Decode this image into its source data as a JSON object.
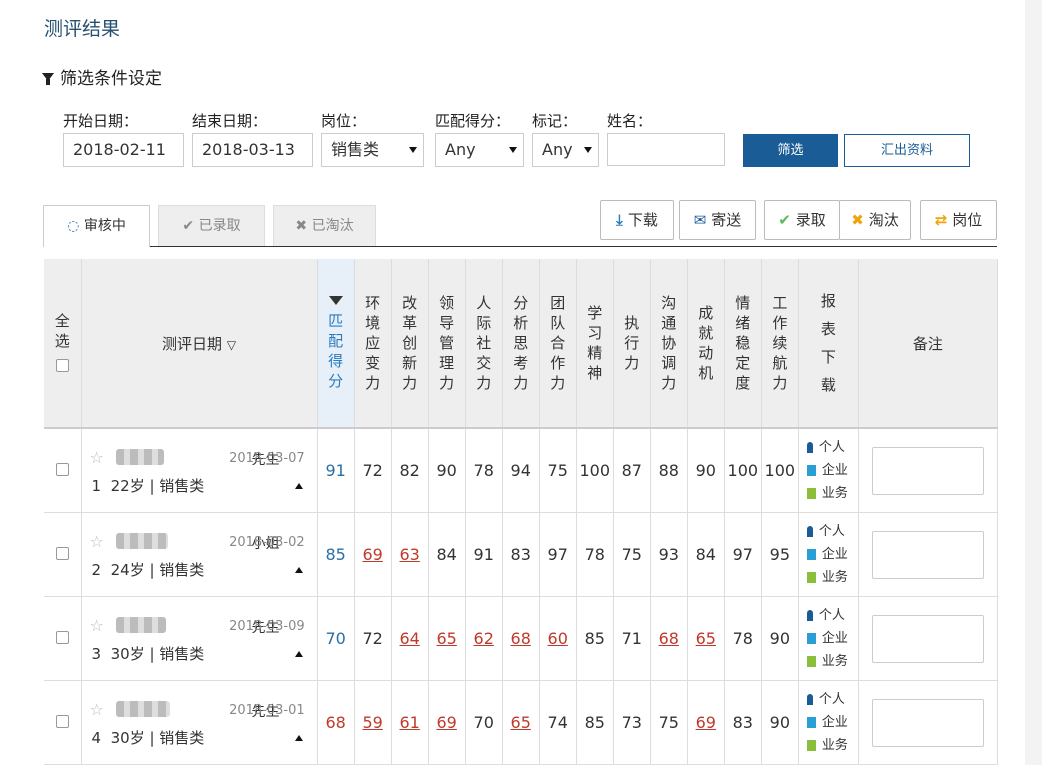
{
  "title": "测评结果",
  "filter_section": {
    "heading": "筛选条件设定"
  },
  "filters": {
    "start_label": "开始日期：",
    "start_value": "2018-02-11",
    "end_label": "结束日期：",
    "end_value": "2018-03-13",
    "position_label": "岗位：",
    "position_value": "销售类",
    "score_label": "匹配得分：",
    "score_value": "Any",
    "mark_label": "标记：",
    "mark_value": "Any",
    "name_label": "姓名：",
    "name_value": "",
    "filter_button": "筛选",
    "export_button": "汇出资料"
  },
  "tabs": [
    {
      "label": "审核中",
      "icon": "spinner-icon",
      "active": true
    },
    {
      "label": "已录取",
      "icon": "check-icon",
      "active": false
    },
    {
      "label": "已淘汰",
      "icon": "x-icon",
      "active": false
    }
  ],
  "actions": {
    "download": "下载",
    "send": "寄送",
    "admit": "录取",
    "reject": "淘汰",
    "position": "岗位"
  },
  "table": {
    "select_all": "全选",
    "date_header": "测评日期",
    "match_header": "匹配得分",
    "competencies": [
      "环境应变力",
      "改革创新力",
      "领导管理力",
      "人际社交力",
      "分析思考力",
      "团队合作力",
      "学习精神",
      "执行力",
      "沟通协调力",
      "成就动机",
      "情绪稳定度",
      "工作续航力"
    ],
    "report_header": "报表下载",
    "note_header": "备注",
    "report_links": {
      "personal": "个人",
      "company": "企业",
      "business": "业务"
    },
    "rows": [
      {
        "index": "1",
        "salutation": "先生",
        "date": "2018-03-07",
        "info": "22岁 | 销售类",
        "match": "91",
        "scores": [
          "72",
          "82",
          "90",
          "78",
          "94",
          "75",
          "100",
          "87",
          "88",
          "90",
          "100",
          "100"
        ],
        "below": [
          false,
          false,
          false,
          false,
          false,
          false,
          false,
          false,
          false,
          false,
          false,
          false
        ]
      },
      {
        "index": "2",
        "salutation": "小姐",
        "date": "2018-03-02",
        "info": "24岁 | 销售类",
        "match": "85",
        "scores": [
          "69",
          "63",
          "84",
          "91",
          "83",
          "97",
          "78",
          "75",
          "93",
          "84",
          "97",
          "95"
        ],
        "below": [
          true,
          true,
          false,
          false,
          false,
          false,
          false,
          false,
          false,
          false,
          false,
          false
        ]
      },
      {
        "index": "3",
        "salutation": "先生",
        "date": "2018-03-09",
        "info": "30岁 | 销售类",
        "match": "70",
        "scores": [
          "72",
          "64",
          "65",
          "62",
          "68",
          "60",
          "85",
          "71",
          "68",
          "65",
          "78",
          "90"
        ],
        "below": [
          false,
          true,
          true,
          true,
          true,
          true,
          false,
          false,
          true,
          true,
          false,
          false
        ]
      },
      {
        "index": "4",
        "salutation": "先生",
        "date": "2018-03-01",
        "info": "30岁 | 销售类",
        "match": "68",
        "scores": [
          "59",
          "61",
          "69",
          "70",
          "65",
          "74",
          "85",
          "73",
          "75",
          "69",
          "83",
          "90"
        ],
        "below": [
          true,
          true,
          true,
          false,
          true,
          false,
          false,
          false,
          false,
          true,
          false,
          false
        ]
      }
    ]
  },
  "colors": {
    "accent": "#1a5d96",
    "title": "#27506f",
    "below_threshold": "#c0392b",
    "match": "#2a6fa6"
  }
}
